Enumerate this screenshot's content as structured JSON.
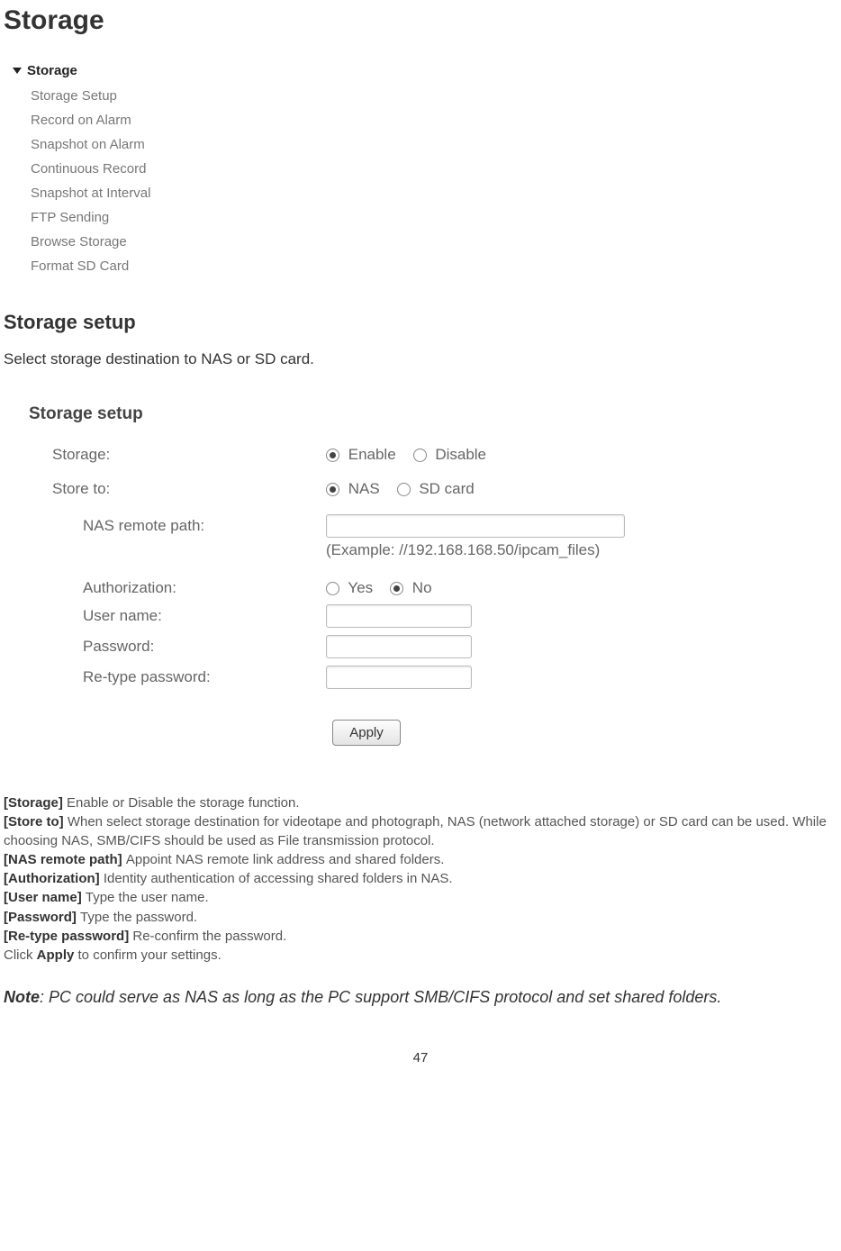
{
  "page_title": "Storage",
  "menu": {
    "header": "Storage",
    "items": [
      "Storage Setup",
      "Record on Alarm",
      "Snapshot on Alarm",
      "Continuous Record",
      "Snapshot at Interval",
      "FTP Sending",
      "Browse Storage",
      "Format SD Card"
    ]
  },
  "section_heading": "Storage setup",
  "section_intro": "Select storage destination to NAS or SD card.",
  "setup": {
    "panel_title": "Storage setup",
    "storage_label": "Storage:",
    "storage_opt_enable": "Enable",
    "storage_opt_disable": "Disable",
    "store_to_label": "Store to:",
    "store_to_nas": "NAS",
    "store_to_sd": "SD card",
    "nas_path_label": "NAS remote path:",
    "nas_path_hint": "(Example: //192.168.168.50/ipcam_files)",
    "auth_label": "Authorization:",
    "auth_yes": "Yes",
    "auth_no": "No",
    "user_label": "User name:",
    "pass_label": "Password:",
    "repass_label": "Re-type password:",
    "apply_label": "Apply"
  },
  "definitions": {
    "storage_k": "[Storage] ",
    "storage_v": "Enable or Disable the storage function.",
    "storeto_k": "[Store to] ",
    "storeto_v": "When select storage destination for videotape and photograph, NAS (network attached storage) or SD card can be used. While choosing NAS, SMB/CIFS should be used as File transmission protocol.",
    "naspath_k": "[NAS remote path] ",
    "naspath_v": "Appoint NAS remote link address and shared folders.",
    "auth_k": "[Authorization] ",
    "auth_v": "Identity authentication of accessing shared folders in NAS.",
    "user_k": "[User name] ",
    "user_v": "Type the user name.",
    "pass_k": "[Password] ",
    "pass_v": "Type the password.",
    "repass_k": "[Re-type password] ",
    "repass_v": "Re-confirm the password.",
    "apply_pre": "Click ",
    "apply_word": "Apply",
    "apply_post": " to confirm your settings."
  },
  "note": {
    "label": "Note",
    "text": ": PC could serve as NAS as long as the PC support SMB/CIFS protocol and set shared folders."
  },
  "page_number": "47"
}
